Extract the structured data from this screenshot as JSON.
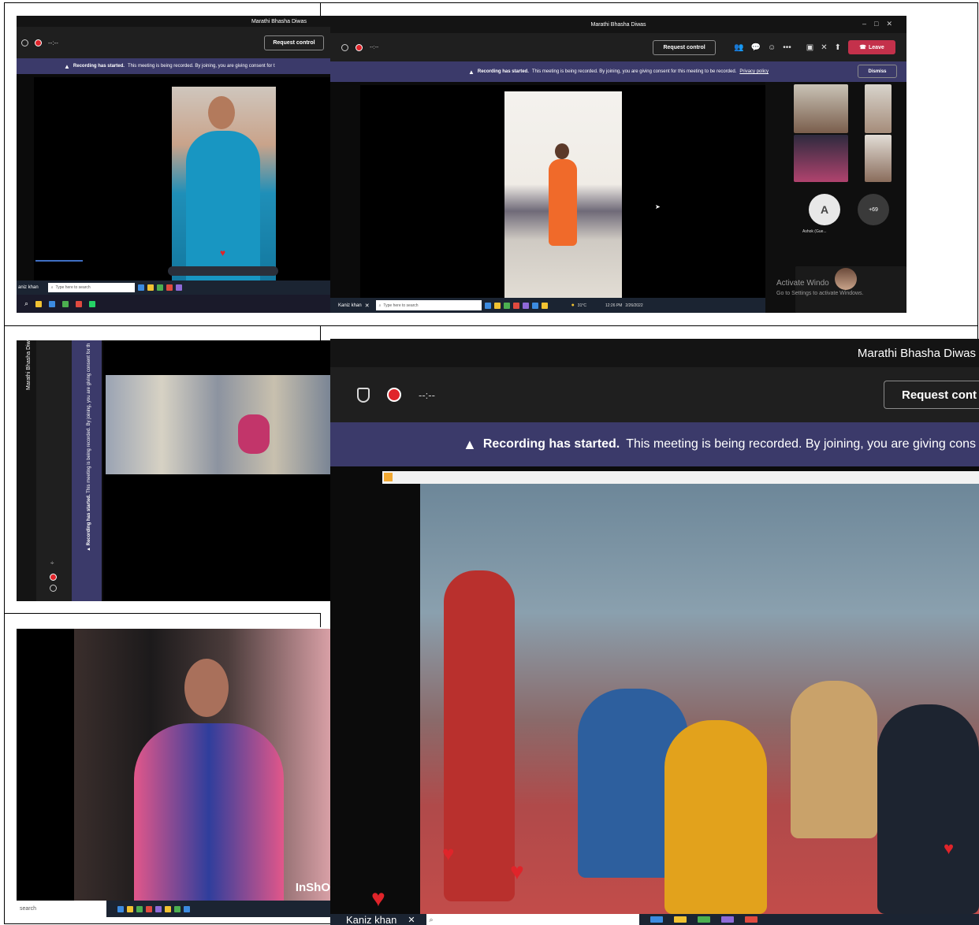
{
  "meeting": {
    "title": "Marathi Bhasha Diwas",
    "timer": "--:--",
    "request_control_label": "Request control",
    "request_control_label_cropped": "Request cont",
    "leave_label": "Leave",
    "dismiss_label": "Dismiss"
  },
  "recording_banner": {
    "bold": "Recording has started.",
    "text": "This meeting is being recorded. By joining, you are giving consent for this meeting to be recorded.",
    "link": "Privacy policy",
    "text_cropped_small": "This meeting is being recorded. By joining, you are giving consent for t",
    "text_cropped_large": "This meeting is being recorded. By joining, you are giving cons",
    "text_vertical": "This meeting is being recorded. By joining, you are giving consent for th"
  },
  "participants": {
    "guest_label": "Ashok (Gue...",
    "guest_initial": "A",
    "more_count": "+69",
    "presenter_name": "Kaniz khan",
    "presenter_name_cropped": "aniz khan"
  },
  "taskbar": {
    "search_placeholder": "Type here to search",
    "search_cropped": "search",
    "weather": "31°C",
    "time": "12:26 PM",
    "date": "2/26/2022"
  },
  "watermarks": {
    "activate_title": "Activate Windo",
    "activate_sub": "Go to Settings to activate Windows.",
    "inshot": "InShO"
  },
  "colors": {
    "banner": "#3b3a6a",
    "leave": "#c4314b",
    "record_dot": "#e0242a",
    "taskbar": "#1b2432"
  }
}
